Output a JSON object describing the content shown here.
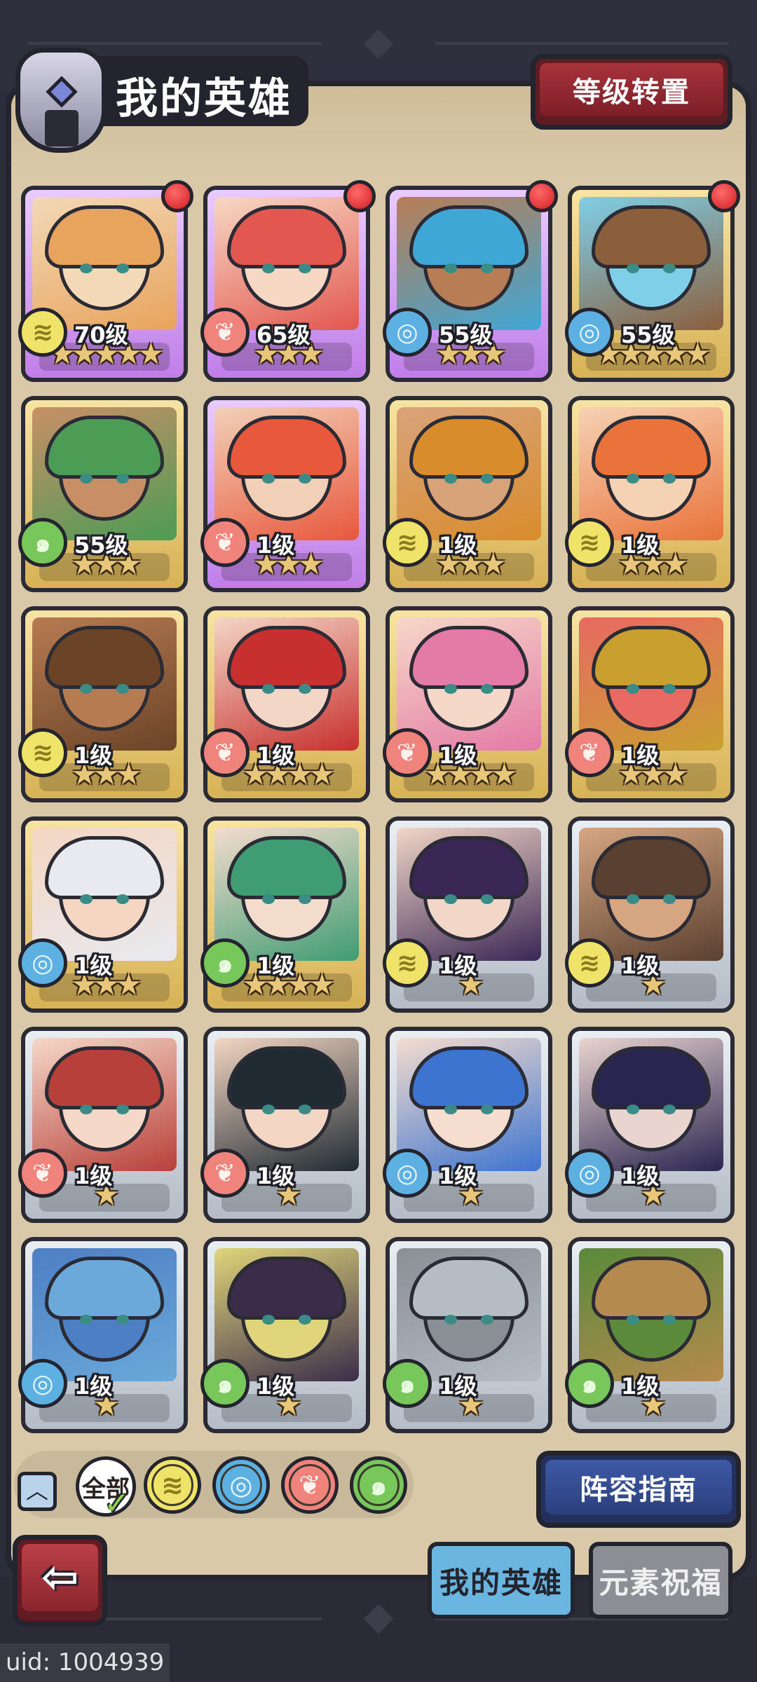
{
  "header": {
    "title": "我的英雄",
    "level_reset_label": "等级转置"
  },
  "colors": {
    "panel": "#d9c9a8",
    "element_yellow": "#efe36a",
    "element_red": "#f0847d",
    "element_blue": "#5db0e2",
    "element_green": "#77c75a"
  },
  "heroes": [
    {
      "level": "70级",
      "element": "yellow",
      "stars": "★★★★★",
      "rarity": "purple",
      "alert": true,
      "palette": [
        "#e8a35c",
        "#f3d9b8"
      ]
    },
    {
      "level": "65级",
      "element": "red",
      "stars": "★★★",
      "rarity": "purple",
      "alert": true,
      "palette": [
        "#e2574f",
        "#f7d8c4"
      ]
    },
    {
      "level": "55级",
      "element": "blue",
      "stars": "★★★",
      "rarity": "purple",
      "alert": true,
      "palette": [
        "#3fa7d6",
        "#b97d55"
      ]
    },
    {
      "level": "55级",
      "element": "blue",
      "stars": "★★★★★",
      "rarity": "gold",
      "alert": true,
      "palette": [
        "#8b5e3c",
        "#7fcfe8"
      ]
    },
    {
      "level": "55级",
      "element": "green",
      "stars": "★★★",
      "rarity": "gold",
      "alert": false,
      "palette": [
        "#4c9c55",
        "#c88f67"
      ]
    },
    {
      "level": "1级",
      "element": "red",
      "stars": "★★★",
      "rarity": "purple",
      "alert": false,
      "palette": [
        "#e8583d",
        "#f2d0b8"
      ]
    },
    {
      "level": "1级",
      "element": "yellow",
      "stars": "★★★",
      "rarity": "gold",
      "alert": false,
      "palette": [
        "#d98c2c",
        "#d9a37a"
      ]
    },
    {
      "level": "1级",
      "element": "yellow",
      "stars": "★★★",
      "rarity": "gold",
      "alert": false,
      "palette": [
        "#e9733a",
        "#f6d2b4"
      ]
    },
    {
      "level": "1级",
      "element": "yellow",
      "stars": "★★★",
      "rarity": "gold",
      "alert": false,
      "palette": [
        "#6b4428",
        "#b77b52"
      ]
    },
    {
      "level": "1级",
      "element": "red",
      "stars": "★★★★",
      "rarity": "gold",
      "alert": false,
      "palette": [
        "#c7302e",
        "#f4d6c6"
      ]
    },
    {
      "level": "1级",
      "element": "red",
      "stars": "★★★★",
      "rarity": "gold",
      "alert": false,
      "palette": [
        "#e47aa6",
        "#f6d8c8"
      ]
    },
    {
      "level": "1级",
      "element": "red",
      "stars": "★★★",
      "rarity": "gold",
      "alert": false,
      "palette": [
        "#c9a030",
        "#e86a62"
      ]
    },
    {
      "level": "1级",
      "element": "blue",
      "stars": "★★★",
      "rarity": "gold",
      "alert": false,
      "palette": [
        "#e8eaf0",
        "#f4d6c2"
      ]
    },
    {
      "level": "1级",
      "element": "green",
      "stars": "★★★★",
      "rarity": "gold",
      "alert": false,
      "palette": [
        "#3f9c73",
        "#f4dccd"
      ]
    },
    {
      "level": "1级",
      "element": "yellow",
      "stars": "★",
      "rarity": "silver",
      "alert": false,
      "palette": [
        "#3a2756",
        "#f2d6c7"
      ]
    },
    {
      "level": "1级",
      "element": "yellow",
      "stars": "★",
      "rarity": "silver",
      "alert": false,
      "palette": [
        "#5a4030",
        "#d6a682"
      ]
    },
    {
      "level": "1级",
      "element": "red",
      "stars": "★",
      "rarity": "silver",
      "alert": false,
      "palette": [
        "#b8403a",
        "#f5d8c8"
      ]
    },
    {
      "level": "1级",
      "element": "red",
      "stars": "★",
      "rarity": "silver",
      "alert": false,
      "palette": [
        "#1f2a33",
        "#f3d6c3"
      ]
    },
    {
      "level": "1级",
      "element": "blue",
      "stars": "★",
      "rarity": "silver",
      "alert": false,
      "palette": [
        "#3d74cf",
        "#f5ddcf"
      ]
    },
    {
      "level": "1级",
      "element": "blue",
      "stars": "★",
      "rarity": "silver",
      "alert": false,
      "palette": [
        "#2a2550",
        "#e9d4d0"
      ]
    },
    {
      "level": "1级",
      "element": "blue",
      "stars": "★",
      "rarity": "silver",
      "alert": false,
      "palette": [
        "#6aa9d9",
        "#4d7fc4"
      ]
    },
    {
      "level": "1级",
      "element": "green",
      "stars": "★",
      "rarity": "silver",
      "alert": false,
      "palette": [
        "#3b2d4a",
        "#e0d57a"
      ]
    },
    {
      "level": "1级",
      "element": "green",
      "stars": "★",
      "rarity": "silver",
      "alert": false,
      "palette": [
        "#b6bcc4",
        "#8a8f96"
      ]
    },
    {
      "level": "1级",
      "element": "green",
      "stars": "★",
      "rarity": "silver",
      "alert": false,
      "palette": [
        "#b58a4e",
        "#5a8a3a"
      ]
    }
  ],
  "filters": {
    "all_label": "全部",
    "elements": [
      "yellow",
      "blue",
      "red",
      "green"
    ]
  },
  "lineup_guide_label": "阵容指南",
  "tabs": {
    "my_heroes": "我的英雄",
    "element_blessing": "元素祝福"
  },
  "uid_text": "uid: 1004939"
}
